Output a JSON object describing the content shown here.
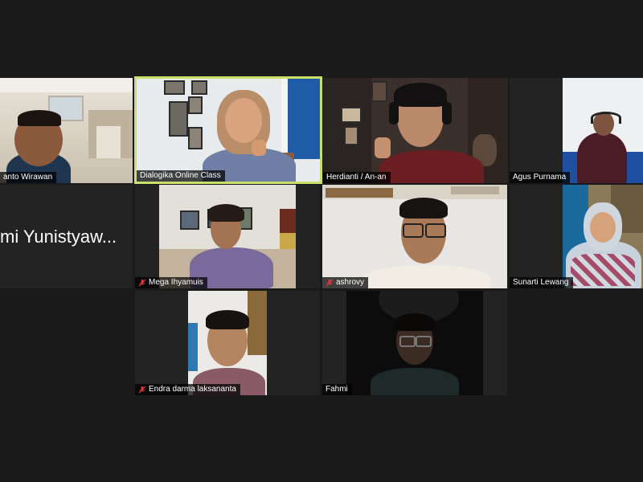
{
  "meeting": {
    "participants": [
      {
        "id": "p1",
        "name": "anto Wirawan",
        "muted": false
      },
      {
        "id": "p2",
        "name": "Dialogika Online Class",
        "muted": false,
        "active_speaker": true
      },
      {
        "id": "p3",
        "name": "Herdianti / An-an",
        "muted": false
      },
      {
        "id": "p4",
        "name": "Agus Purnama",
        "muted": false
      },
      {
        "id": "p5",
        "name": "mi Yunistyaw...",
        "muted": false,
        "video_off": true
      },
      {
        "id": "p6",
        "name": "Mega Ihyamuis",
        "muted": true
      },
      {
        "id": "p7",
        "name": "ashrovy",
        "muted": true
      },
      {
        "id": "p8",
        "name": "Sunarti Lewang",
        "muted": false
      },
      {
        "id": "p9",
        "name": "Endra darma laksananta",
        "muted": true
      },
      {
        "id": "p10",
        "name": "Fahmi",
        "muted": false
      }
    ]
  },
  "colors": {
    "background": "#1a1a1a",
    "tile": "#232323",
    "active_speaker_border": "#c9e06b",
    "muted_icon": "#e0393e"
  },
  "icons": {
    "muted": "mic-off-icon"
  }
}
